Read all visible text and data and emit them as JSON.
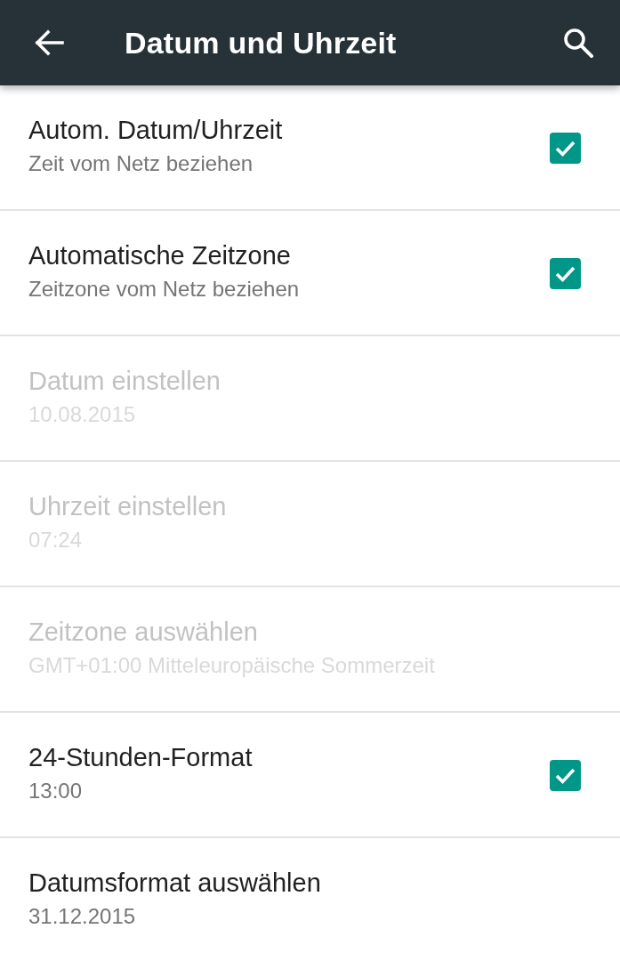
{
  "app_bar": {
    "title": "Datum und Uhrzeit"
  },
  "settings": [
    {
      "kind": "checkbox",
      "title": "Autom. Datum/Uhrzeit",
      "summary": "Zeit vom Netz beziehen",
      "disabled": false,
      "checked": true
    },
    {
      "kind": "checkbox",
      "title": "Automatische Zeitzone",
      "summary": "Zeitzone vom Netz beziehen",
      "disabled": false,
      "checked": true
    },
    {
      "kind": "plain",
      "title": "Datum einstellen",
      "summary": "10.08.2015",
      "disabled": true
    },
    {
      "kind": "plain",
      "title": "Uhrzeit einstellen",
      "summary": "07:24",
      "disabled": true
    },
    {
      "kind": "plain",
      "title": "Zeitzone auswählen",
      "summary": "GMT+01:00 Mitteleuropäische Sommerzeit",
      "disabled": true
    },
    {
      "kind": "checkbox",
      "title": "24-Stunden-Format",
      "summary": "13:00",
      "disabled": false,
      "checked": true
    },
    {
      "kind": "plain",
      "title": "Datumsformat auswählen",
      "summary": "31.12.2015",
      "disabled": false
    }
  ]
}
